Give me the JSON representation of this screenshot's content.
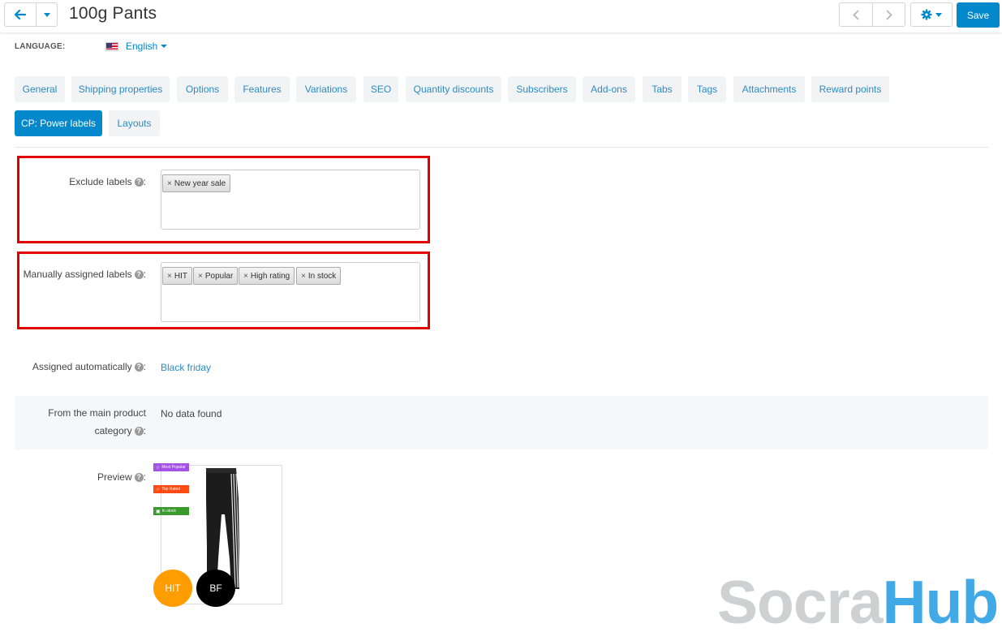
{
  "header": {
    "title": "100g Pants",
    "save_label": "Save"
  },
  "language": {
    "label": "LANGUAGE:",
    "value": "English"
  },
  "tabs": [
    {
      "label": "General"
    },
    {
      "label": "Shipping properties"
    },
    {
      "label": "Options"
    },
    {
      "label": "Features"
    },
    {
      "label": "Variations"
    },
    {
      "label": "SEO"
    },
    {
      "label": "Quantity discounts"
    },
    {
      "label": "Subscribers"
    },
    {
      "label": "Add-ons"
    },
    {
      "label": "Tabs"
    },
    {
      "label": "Tags"
    },
    {
      "label": "Attachments"
    },
    {
      "label": "Reward points"
    },
    {
      "label": "CP: Power labels",
      "active": true
    },
    {
      "label": "Layouts"
    }
  ],
  "form": {
    "exclude": {
      "label": "Exclude labels",
      "tags": [
        "New year sale"
      ]
    },
    "manual": {
      "label": "Manually assigned labels",
      "tags": [
        "HIT",
        "Popular",
        "High rating",
        "In stock"
      ]
    },
    "auto": {
      "label": "Assigned automatically",
      "value": "Black friday"
    },
    "category": {
      "label_line1": "From the main product",
      "label_line2": "category",
      "value": "No data found"
    },
    "preview": {
      "label": "Preview",
      "ribbons": [
        {
          "text": "Most Popular",
          "color": "#a351e6"
        },
        {
          "text": "Top Rated",
          "color": "#ff4a14"
        },
        {
          "text": "In stock",
          "color": "#3b9a2e"
        }
      ],
      "badges": [
        {
          "text": "HIT",
          "color": "#ff9c00"
        },
        {
          "text": "BF",
          "color": "#000000"
        }
      ]
    }
  },
  "watermark": {
    "part1": "Socra",
    "part2": "Hub"
  },
  "colors": {
    "accent": "#0388cc",
    "highlight": "#e00000"
  }
}
